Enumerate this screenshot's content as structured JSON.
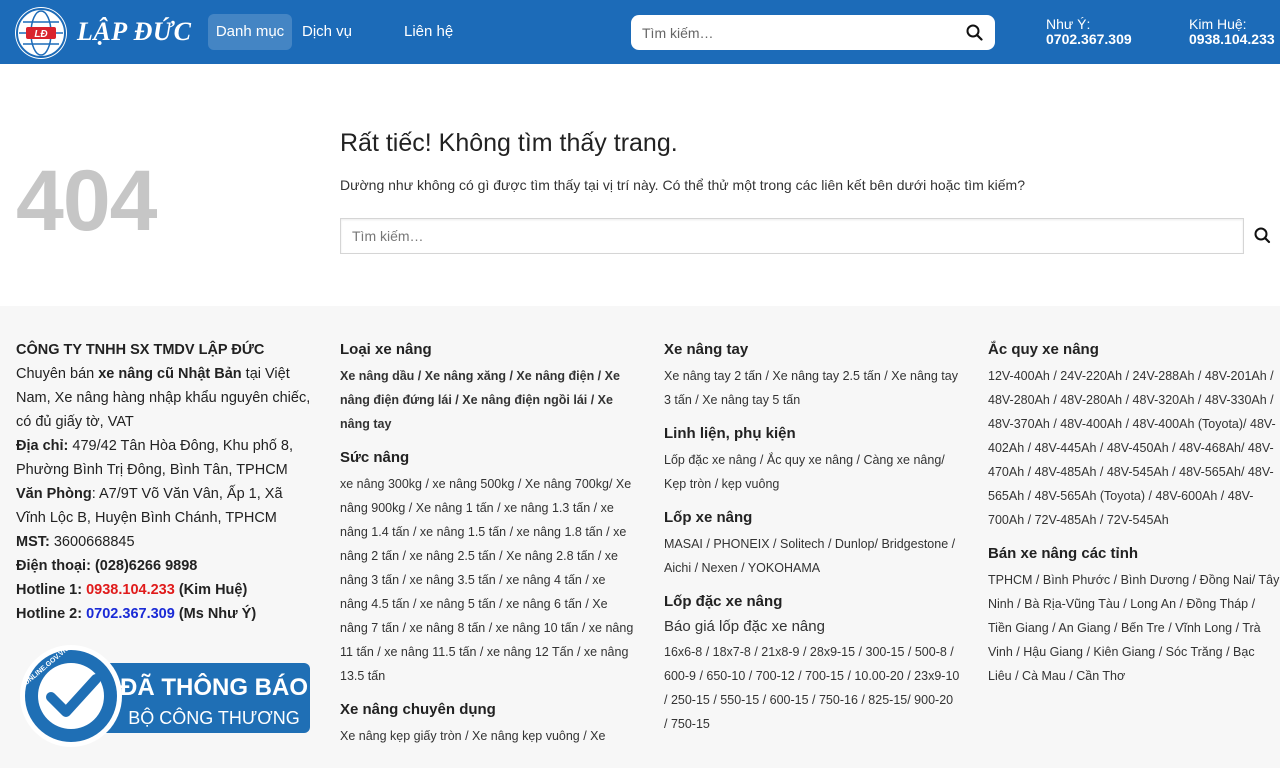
{
  "header": {
    "logo_text": "LẬP ĐỨC",
    "logo_badge": "LĐ",
    "nav": [
      "Danh mục",
      "Dịch vụ",
      "Liên hệ"
    ],
    "search_placeholder": "Tìm kiếm…",
    "hotlines": [
      {
        "label": "Như Ý:",
        "number": "0702.367.309"
      },
      {
        "label": "Kim Huệ:",
        "number": "0938.104.233"
      }
    ],
    "colors": {
      "bar": "#1c6bb8"
    }
  },
  "not_found": {
    "code": "404",
    "title": "Rất tiếc! Không tìm thấy trang.",
    "description": "Dường như không có gì được tìm thấy tại vị trí này. Có thể thử một trong các liên kết bên dưới hoặc tìm kiếm?",
    "search_placeholder": "Tìm kiếm…"
  },
  "company": {
    "name": "CÔNG TY TNHH SX TMDV LẬP ĐỨC",
    "intro_1": "Chuyên bán ",
    "intro_bold": "xe nâng cũ Nhật Bản",
    "intro_2": " tại Việt Nam, Xe nâng hàng nhập khẩu nguyên chiếc, có đủ giấy tờ, VAT",
    "address_label": "Địa chỉ:",
    "address": " 479/42 Tân Hòa Đông, Khu phố 8, Phường Bình Trị Đông, Bình Tân, TPHCM",
    "office_label": "Văn Phòng",
    "office": ": A7/9T Võ Văn Vân, Ấp 1, Xã Vĩnh Lộc B, Huyện Bình Chánh, TPHCM",
    "mst_label": "MST:",
    "mst": " 3600668845",
    "phone_label": "Điện thoại:",
    "phone": " (028)6266 9898",
    "hotline1_label": "Hotline 1: ",
    "hotline1_number": "0938.104.233",
    "hotline1_name": " (Kim Huệ)",
    "hotline2_label": "Hotline 2: ",
    "hotline2_number": "0702.367.309",
    "hotline2_name": " (Ms Như Ý)",
    "badge_line1": "ĐÃ THÔNG BÁO",
    "badge_line2": "BỘ CÔNG THƯƠNG",
    "badge_ring": "ONLINE.GOV.VN"
  },
  "col2": {
    "h1": "Loại xe nâng",
    "t1": "Xe nâng dầu / Xe nâng xăng / Xe nâng điện / Xe nâng điện đứng lái / Xe nâng điện ngồi lái / Xe nâng tay",
    "h2": "Sức nâng",
    "t2": "xe nâng 300kg / xe nâng 500kg / Xe nâng 700kg/ Xe nâng 900kg / Xe nâng 1 tấn / xe nâng 1.3 tấn / xe nâng 1.4 tấn / xe nâng 1.5 tấn / xe nâng 1.8 tấn / xe nâng 2 tấn / xe nâng 2.5 tấn / Xe nâng 2.8 tấn / xe nâng 3 tấn / xe nâng 3.5 tấn / xe nâng 4 tấn / xe nâng 4.5 tấn / xe nâng 5 tấn / xe nâng 6 tấn / Xe nâng 7 tấn / xe nâng 8 tấn / xe nâng 10 tấn / xe nâng 11 tấn / xe nâng 11.5 tấn / xe nâng 12 Tấn / xe nâng 13.5 tấn",
    "h3": "Xe nâng chuyên dụng",
    "t3": "Xe nâng kẹp giấy tròn / Xe nâng kẹp vuông / Xe"
  },
  "col3": {
    "h1": "Xe nâng tay",
    "t1": "Xe nâng tay 2 tấn / Xe nâng tay 2.5 tấn / Xe nâng tay 3 tấn / Xe nâng tay 5 tấn",
    "h2": "Linh liện, phụ kiện",
    "t2": "Lốp đặc xe nâng / Ắc quy xe nâng / Càng xe nâng/ Kẹp tròn / kẹp vuông",
    "h3": "Lốp xe nâng",
    "t3": "MASAI / PHONEIX / Solitech / Dunlop/ Bridgestone / Aichi / Nexen / YOKOHAMA",
    "h4": "Lốp đặc xe nâng",
    "sub4": "Báo giá lốp đặc xe nâng",
    "t4": "16x6-8 / 18x7-8 / 21x8-9 / 28x9-15 / 300-15 / 500-8 / 600-9 / 650-10 / 700-12 / 700-15 / 10.00-20 / 23x9-10 / 250-15 / 550-15 / 600-15 / 750-16 / 825-15/ 900-20 / 750-15"
  },
  "col4": {
    "h1": "Ắc quy xe nâng",
    "t1": "12V-400Ah / 24V-220Ah / 24V-288Ah / 48V-201Ah / 48V-280Ah / 48V-280Ah / 48V-320Ah / 48V-330Ah / 48V-370Ah / 48V-400Ah / 48V-400Ah (Toyota)/ 48V-402Ah / 48V-445Ah / 48V-450Ah / 48V-468Ah/ 48V-470Ah / 48V-485Ah / 48V-545Ah / 48V-565Ah/ 48V-565Ah / 48V-565Ah (Toyota) / 48V-600Ah / 48V-700Ah / 72V-485Ah / 72V-545Ah",
    "h2": "Bán xe nâng các tỉnh",
    "t2": "TPHCM / Bình Phước / Bình Dương / Đồng Nai/ Tây Ninh / Bà Rịa-Vũng Tàu / Long An / Đồng Tháp / Tiền Giang / An Giang / Bến Tre / Vĩnh Long / Trà Vinh / Hậu Giang / Kiên Giang / Sóc Trăng / Bạc Liêu / Cà Mau / Cần Thơ"
  }
}
